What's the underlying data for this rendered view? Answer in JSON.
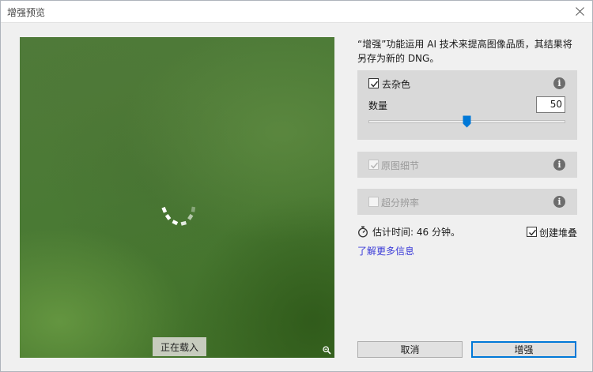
{
  "window": {
    "title": "增强预览"
  },
  "preview": {
    "loading_label": "正在载入"
  },
  "description": "“增强”功能运用 AI 技术来提高图像品质，其结果将另存为新的 DNG。",
  "denoise": {
    "label": "去杂色",
    "checked": true,
    "amount_label": "数量",
    "amount_value": "50",
    "slider_fraction": 0.5
  },
  "raw_details": {
    "label": "原图细节",
    "checked": true,
    "disabled": true
  },
  "super_resolution": {
    "label": "超分辨率",
    "checked": false,
    "disabled": true
  },
  "estimate": {
    "text": "估计时间: 46 分钟。"
  },
  "create_stack": {
    "label": "创建堆叠",
    "checked": true
  },
  "learn_more": "了解更多信息",
  "buttons": {
    "cancel": "取消",
    "enhance": "增强"
  },
  "colors": {
    "accent": "#0078d7",
    "link": "#3b3bd8",
    "section_bg": "#d9d9d9"
  },
  "icons": [
    "close-icon",
    "spinner-icon",
    "zoom-out-icon",
    "checkmark-icon",
    "info-icon",
    "stopwatch-icon",
    "slider-thumb-icon"
  ]
}
